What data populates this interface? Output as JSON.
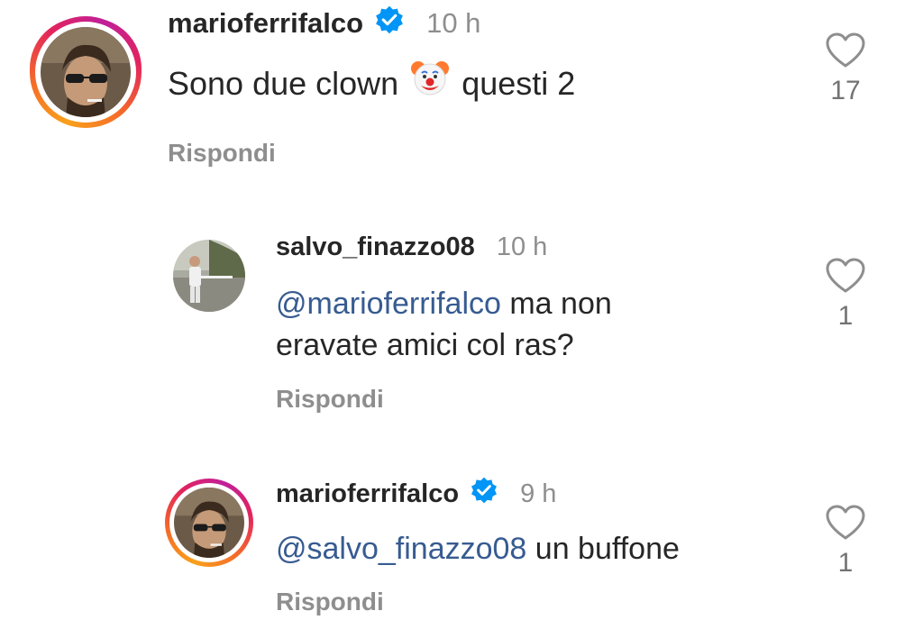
{
  "comments": [
    {
      "username": "marioferrifalco",
      "verified": true,
      "time": "10 h",
      "text_before": "Sono due clown",
      "emoji": "clown-face-emoji",
      "text_after": "questi 2",
      "reply_label": "Rispondi",
      "likes": "17"
    },
    {
      "username": "salvo_finazzo08",
      "verified": false,
      "time": "10 h",
      "mention": "@marioferrifalco",
      "text_line1": "ma non",
      "text_line2": "eravate amici col ras?",
      "reply_label": "Rispondi",
      "likes": "1"
    },
    {
      "username": "marioferrifalco",
      "verified": true,
      "time": "9 h",
      "mention": "@salvo_finazzo08",
      "text": "un buffone",
      "reply_label": "Rispondi",
      "likes": "1"
    }
  ],
  "colors": {
    "verified_blue": "#0095f6",
    "mention_blue": "#375b91",
    "muted_gray": "#8e8e8e",
    "text": "#262626"
  }
}
